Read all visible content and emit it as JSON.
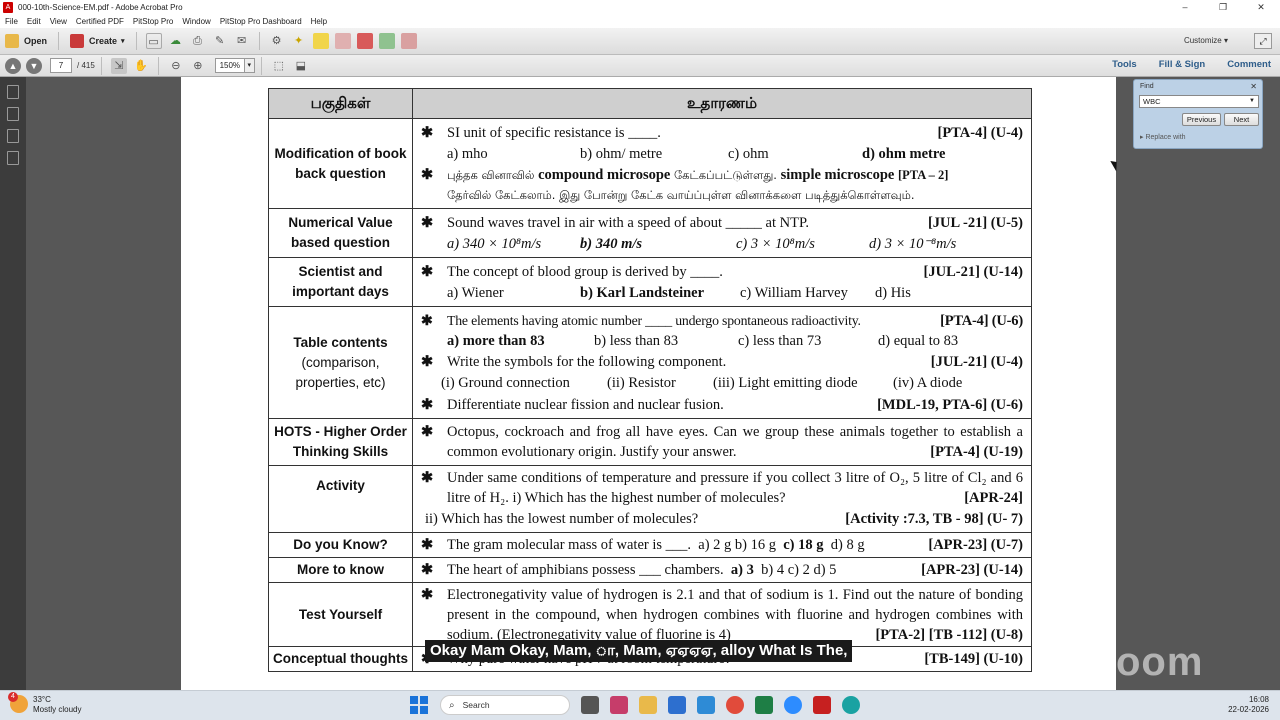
{
  "window": {
    "title": "000-10th-Science-EM.pdf - Adobe Acrobat Pro",
    "controls": [
      "–",
      "❐",
      "✕"
    ]
  },
  "menu": [
    "File",
    "Edit",
    "View",
    "Certified PDF",
    "PitStop Pro",
    "Window",
    "PitStop Pro Dashboard",
    "Help"
  ],
  "toolbar": {
    "open_label": "Open",
    "create_label": "Create",
    "customize_label": "Customize"
  },
  "nav": {
    "page_current": "7",
    "page_total": "/ 415",
    "zoom": "150%"
  },
  "right_tabs": [
    "Tools",
    "Fill & Sign",
    "Comment"
  ],
  "find": {
    "label": "Find",
    "value": "WBC",
    "previous": "Previous",
    "next": "Next",
    "replace": "Replace with"
  },
  "document": {
    "header_col1": "பகுதிகள்",
    "header_col2": "உதாரணம்",
    "rows": {
      "modification": {
        "category": "Modification of book back question",
        "q1": "SI unit of specific resistance is ____.",
        "q1_tag": "[PTA-4] (U-4)",
        "q1_opts": [
          "a) mho",
          "b) ohm/ metre",
          "c) ohm",
          "d) ohm metre"
        ],
        "note_1": "புத்தக வினாவில்",
        "note_2": "compound microsope",
        "note_3": "கேட்கப்பட்டுள்ளது.",
        "note_4": "simple microscope",
        "note_5": "[PTA – 2]",
        "note_6": "தேர்வில் கேட்கலாம். இது போன்று கேட்க வாய்ப்புள்ள வினாக்களை படித்துக்கொள்ளவும்."
      },
      "numerical": {
        "category": "Numerical Value based question",
        "q": "Sound waves travel in air with a speed of about _____ at NTP.",
        "tag": "[JUL -21] (U-5)",
        "opts": [
          "a) 340 × 10⁸m/s",
          "b) 340 m/s",
          "c) 3 × 10⁸m/s",
          "d) 3 × 10⁻⁸m/s"
        ]
      },
      "scientist": {
        "category": "Scientist and important days",
        "q": "The concept of blood group is derived by ____.",
        "tag": "[JUL-21] (U-14)",
        "opts": [
          "a) Wiener",
          "b) Karl Landsteiner",
          "c) William Harvey",
          "d) His"
        ]
      },
      "table": {
        "category": "Table contents",
        "category_sub": "(comparison, properties, etc)",
        "q1": "The elements having atomic number ____ undergo spontaneous radioactivity.",
        "q1_tag": "[PTA-4] (U-6)",
        "q1_opts": [
          "a) more than 83",
          "b) less than 83",
          "c) less than 73",
          "d) equal to 83"
        ],
        "q2": "Write the symbols for the following component.",
        "q2_tag": "[JUL-21] (U-4)",
        "q2_opts": [
          "(i) Ground connection",
          "(ii) Resistor",
          "(iii) Light emitting diode",
          "(iv) A diode"
        ],
        "q3": "Differentiate nuclear fission and nuclear fusion.",
        "q3_tag": "[MDL-19, PTA-6] (U-6)"
      },
      "hots": {
        "category": "HOTS - Higher Order Thinking Skills",
        "q": "Octopus, cockroach and frog all have eyes. Can we group these animals together to establish a common evolutionary origin. Justify your answer.",
        "tag": "[PTA-4] (U-19)"
      },
      "activity": {
        "category": "Activity",
        "q": "Under same conditions of temperature and pressure if you collect 3 litre of O₂, 5 litre of Cl₂ and 6 litre of H₂. i) Which has the highest number of molecules?",
        "tag1": "[APR-24]",
        "q2": "ii) Which has the lowest number of molecules?",
        "tag2": "[Activity :7.3, TB - 98] (U- 7)"
      },
      "doyouknow": {
        "category": "Do you Know?",
        "q": "The gram molecular mass of water is ___.",
        "opts": "a) 2 g   b) 16 g",
        "ans": "c) 18 g",
        "opts2": "d) 8 g",
        "tag": "[APR-23] (U-7)"
      },
      "moretoknow": {
        "category": "More to know",
        "q": "The heart of amphibians possess ___ chambers.",
        "ans": "a) 3",
        "opts": "b) 4   c) 2   d) 5",
        "tag": "[APR-23] (U-14)"
      },
      "testyourself": {
        "category": "Test Yourself",
        "q": "Electronegativity value of hydrogen is 2.1 and that of sodium is 1. Find out the nature of bonding present in the compound, when hydrogen combines with fluorine and hydrogen combines with sodium. (Electronegativity value of fluorine is 4)",
        "tag": "[PTA-2] [TB -112] (U-8)"
      },
      "conceptual": {
        "category": "Conceptual thoughts",
        "q": "Why pure water have pH 7 at room temperature?",
        "tag": "[TB-149] (U-10)"
      }
    }
  },
  "caption": "Okay Mam Okay, Mam, ா, Mam, ஏஏஏஏ, alloy What Is The,",
  "watermark": "zoom",
  "taskbar": {
    "temp": "33°C",
    "weather": "Mostly cloudy",
    "badge": "4",
    "search_label": "Search",
    "time": "16:08",
    "date": "22-02-2026"
  }
}
